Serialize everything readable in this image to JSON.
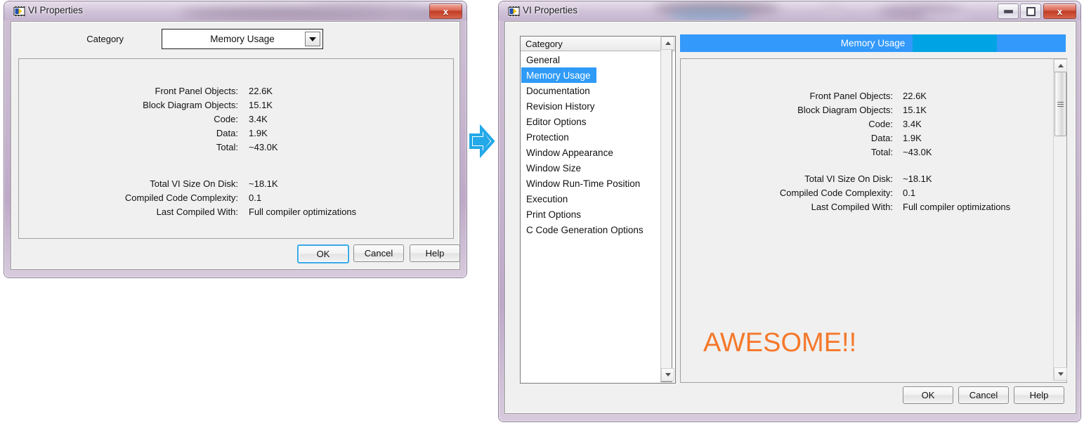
{
  "left_window": {
    "title": "VI Properties",
    "icon": "labview-vi-icon",
    "close_label": "x",
    "category_label": "Category",
    "category_value": "Memory Usage",
    "stats": [
      {
        "label": "Front Panel Objects:",
        "value": "22.6K"
      },
      {
        "label": "Block Diagram Objects:",
        "value": "15.1K"
      },
      {
        "label": "Code:",
        "value": "3.4K"
      },
      {
        "label": "Data:",
        "value": "1.9K"
      },
      {
        "label": "Total:",
        "value": "~43.0K"
      }
    ],
    "stats2": [
      {
        "label": "Total VI Size On Disk:",
        "value": "~18.1K"
      },
      {
        "label": "Compiled Code Complexity:",
        "value": "0.1"
      },
      {
        "label": "Last Compiled With:",
        "value": "Full compiler optimizations"
      }
    ],
    "buttons": {
      "ok": "OK",
      "cancel": "Cancel",
      "help": "Help"
    }
  },
  "transition": {
    "icon": "right-arrow-icon",
    "color": "#23a8e8"
  },
  "right_window": {
    "title": "VI Properties",
    "icon": "labview-vi-icon",
    "minimize_label": "minimize",
    "maximize_label": "maximize",
    "close_label": "x",
    "list_header": "Category",
    "categories": [
      "General",
      "Memory Usage",
      "Documentation",
      "Revision History",
      "Editor Options",
      "Protection",
      "Window Appearance",
      "Window Size",
      "Window Run-Time Position",
      "Execution",
      "Print Options",
      "C Code Generation Options"
    ],
    "selected_category": "Memory Usage",
    "panel_header": "Memory Usage",
    "panel_header_color": "#3399fb",
    "panel_header_accent_color": "#00a4e4",
    "stats": [
      {
        "label": "Front Panel Objects:",
        "value": "22.6K"
      },
      {
        "label": "Block Diagram Objects:",
        "value": "15.1K"
      },
      {
        "label": "Code:",
        "value": "3.4K"
      },
      {
        "label": "Data:",
        "value": "1.9K"
      },
      {
        "label": "Total:",
        "value": "~43.0K"
      }
    ],
    "stats2": [
      {
        "label": "Total VI Size On Disk:",
        "value": "~18.1K"
      },
      {
        "label": "Compiled Code Complexity:",
        "value": "0.1"
      },
      {
        "label": "Last Compiled With:",
        "value": "Full compiler optimizations"
      }
    ],
    "annotation": "AWESOME!!",
    "annotation_color": "#f5782a",
    "buttons": {
      "ok": "OK",
      "cancel": "Cancel",
      "help": "Help"
    }
  }
}
